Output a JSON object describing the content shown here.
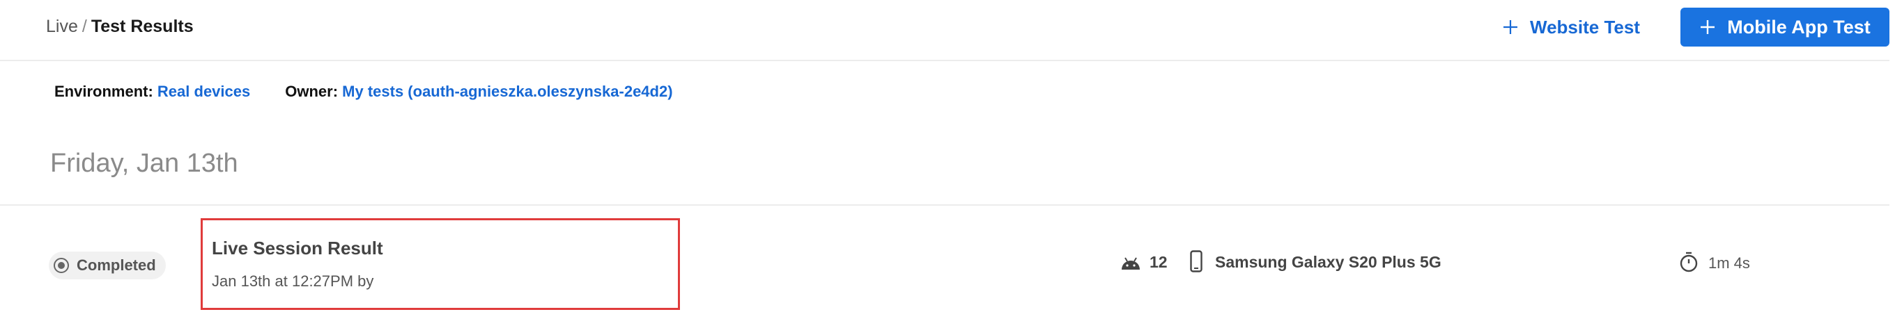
{
  "breadcrumb": {
    "parent": "Live",
    "separator": "/",
    "current": "Test Results"
  },
  "header": {
    "website_test_label": "Website Test",
    "mobile_app_test_label": "Mobile App Test"
  },
  "filters": {
    "environment": {
      "label": "Environment:",
      "value": "Real devices"
    },
    "owner": {
      "label": "Owner:",
      "value": "My tests (oauth-agnieszka.oleszynska-2e4d2)"
    }
  },
  "date_heading": "Friday, Jan 13th",
  "session": {
    "status": "Completed",
    "title": "Live Session Result",
    "meta": "Jan 13th at 12:27PM by",
    "os_icon": "android-icon",
    "os_version": "12",
    "device_icon": "phone-icon",
    "device": "Samsung Galaxy S20 Plus 5G",
    "duration_icon": "timer-icon",
    "duration": "1m 4s"
  },
  "colors": {
    "accent": "#1a73e0",
    "link": "#1768d4",
    "highlight_border": "#e03b3b",
    "badge_bg": "#f1f1f1"
  }
}
